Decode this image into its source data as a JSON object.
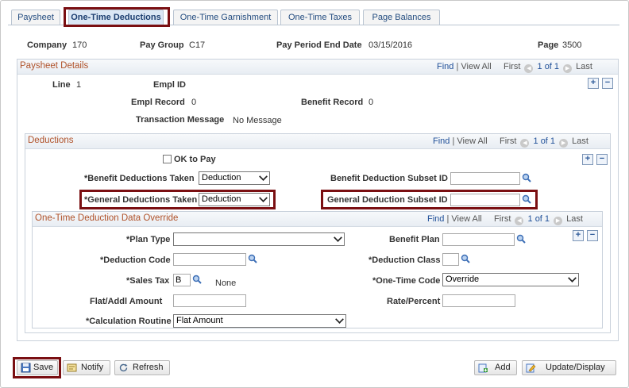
{
  "tabs": [
    {
      "label": "Paysheet"
    },
    {
      "label": "One-Time Deductions"
    },
    {
      "label": "One-Time Garnishment"
    },
    {
      "label": "One-Time Taxes"
    },
    {
      "label": "Page Balances"
    }
  ],
  "header": {
    "company_label": "Company",
    "company_value": "170",
    "pay_group_label": "Pay Group",
    "pay_group_value": "C17",
    "period_end_label": "Pay Period End Date",
    "period_end_value": "03/15/2016",
    "page_label": "Page",
    "page_value": "3500"
  },
  "paysheet_details": {
    "title": "Paysheet Details",
    "find": "Find",
    "sep": "|",
    "view_all": "View All",
    "first": "First",
    "count": "1 of 1",
    "last": "Last",
    "line_label": "Line",
    "line_value": "1",
    "empl_id_label": "Empl ID",
    "empl_record_label": "Empl Record",
    "empl_record_value": "0",
    "benefit_record_label": "Benefit Record",
    "benefit_record_value": "0",
    "txn_msg_label": "Transaction Message",
    "txn_msg_value": "No Message"
  },
  "deductions": {
    "title": "Deductions",
    "find": "Find",
    "sep": "|",
    "view_all": "View All",
    "first": "First",
    "count": "1 of 1",
    "last": "Last",
    "ok_to_pay_label": "OK to Pay",
    "benefit_taken_label": "*Benefit Deductions Taken",
    "benefit_taken_value": "Deduction",
    "benefit_subset_label": "Benefit Deduction Subset ID",
    "benefit_subset_value": "",
    "general_taken_label": "*General Deductions Taken",
    "general_taken_value": "Deduction",
    "general_subset_label": "General Deduction Subset ID",
    "general_subset_value": ""
  },
  "override": {
    "title": "One-Time Deduction Data Override",
    "find": "Find",
    "sep": "|",
    "view_all": "View All",
    "first": "First",
    "count": "1 of 1",
    "last": "Last",
    "plan_type_label": "*Plan Type",
    "plan_type_value": "",
    "benefit_plan_label": "Benefit Plan",
    "benefit_plan_value": "",
    "deduction_code_label": "*Deduction Code",
    "deduction_code_value": "",
    "deduction_class_label": "*Deduction Class",
    "deduction_class_value": "",
    "sales_tax_label": "*Sales Tax",
    "sales_tax_value": "B",
    "sales_tax_desc": "None",
    "one_time_code_label": "*One-Time Code",
    "one_time_code_value": "Override",
    "flat_amount_label": "Flat/Addl Amount",
    "flat_amount_value": "",
    "rate_percent_label": "Rate/Percent",
    "rate_percent_value": "",
    "calc_routine_label": "*Calculation Routine",
    "calc_routine_value": "Flat Amount"
  },
  "toolbar": {
    "save": "Save",
    "notify": "Notify",
    "refresh": "Refresh",
    "add": "Add",
    "update_display": "Update/Display"
  },
  "icons": {
    "plus": "+",
    "minus": "−",
    "prev": "◀",
    "next": "▶"
  },
  "colors": {
    "highlight_border": "#7a0f12",
    "section_title": "#b0522a",
    "link": "#1f4f98"
  }
}
